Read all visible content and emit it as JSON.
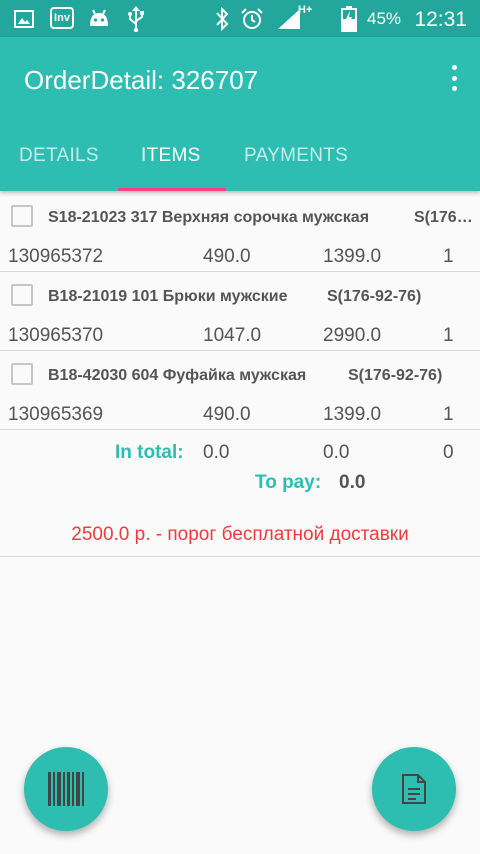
{
  "status_bar": {
    "battery": "45%",
    "time": "12:31",
    "network": "H+",
    "icons": [
      "image-icon",
      "inv-app-icon",
      "android-icon",
      "usb-icon",
      "bluetooth-icon",
      "alarm-icon",
      "signal-icon",
      "battery-icon"
    ],
    "inv_label": "Inv"
  },
  "toolbar": {
    "title": "OrderDetail: 326707",
    "menu_icon": "more-vert-icon"
  },
  "tabs": [
    {
      "label": "DETAILS",
      "active": false
    },
    {
      "label": "ITEMS",
      "active": true
    },
    {
      "label": "PAYMENTS",
      "active": false
    }
  ],
  "items": [
    {
      "name": "S18-21023 317 Верхняя сорочка мужская",
      "size": "S(176…",
      "code": "130965372",
      "price": "490.0",
      "retail": "1399.0",
      "qty": "1",
      "checked": false
    },
    {
      "name": "B18-21019 101 Брюки мужские",
      "size": "S(176-92-76)",
      "code": "130965370",
      "price": "1047.0",
      "retail": "2990.0",
      "qty": "1",
      "checked": false
    },
    {
      "name": "B18-42030 604 Фуфайка мужская",
      "size": "S(176-92-76)",
      "code": "130965369",
      "price": "490.0",
      "retail": "1399.0",
      "qty": "1",
      "checked": false
    }
  ],
  "totals": {
    "in_total_label": "In total:",
    "in_total_price": "0.0",
    "in_total_retail": "0.0",
    "in_total_qty": "0",
    "to_pay_label": "To pay:",
    "to_pay_value": "0.0"
  },
  "free_delivery_threshold": "2500.0 р. - порог бесплатной доставки",
  "fabs": {
    "left_icon": "barcode-icon",
    "right_icon": "document-icon"
  },
  "colors": {
    "primary": "#2ebdb1",
    "primary_dark": "#23a79c",
    "accent": "#ff4081",
    "warning": "#ee3b3b"
  }
}
